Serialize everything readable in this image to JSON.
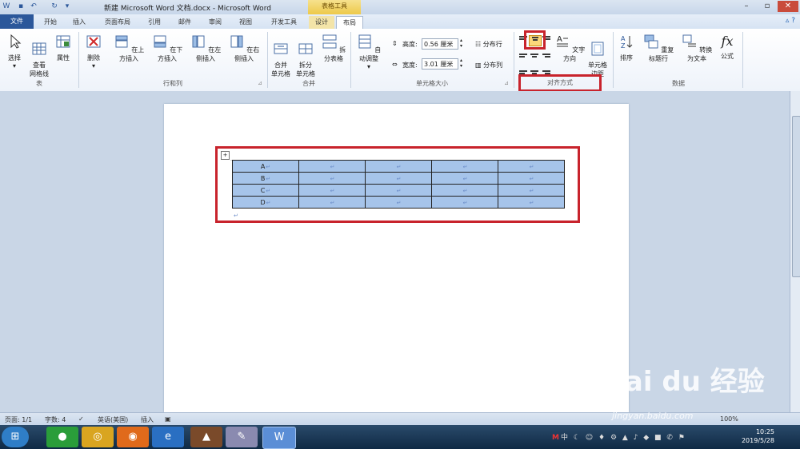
{
  "window": {
    "title": "新建 Microsoft Word 文档.docx - Microsoft Word",
    "context_tab_group": "表格工具",
    "app_icon": "W"
  },
  "tabs": [
    "开始",
    "插入",
    "页面布局",
    "引用",
    "邮件",
    "审阅",
    "视图",
    "开发工具"
  ],
  "file_tab": "文件",
  "context_tabs": [
    "设计",
    "布局"
  ],
  "ribbon": {
    "table": {
      "select": "选择",
      "gridlines": "查看\n网格线",
      "properties": "属性",
      "label": "表"
    },
    "rows_cols": {
      "delete": "删除",
      "insert_above": "在上方插入",
      "insert_below": "在下方插入",
      "insert_left": "在左侧插入",
      "insert_right": "在右侧插入",
      "label": "行和列"
    },
    "merge": {
      "merge_cells": "合并\n单元格",
      "split_cells": "拆分\n单元格",
      "split_table": "拆分表格",
      "label": "合并"
    },
    "cell_size": {
      "autofit": "自动调整",
      "height_label": "高度:",
      "height_value": "0.56 厘米",
      "width_label": "宽度:",
      "width_value": "3.01 厘米",
      "dist_rows": "分布行",
      "dist_cols": "分布列",
      "label": "单元格大小"
    },
    "alignment": {
      "text_direction": "文字方向",
      "cell_margins": "单元格\n边距",
      "label": "对齐方式"
    },
    "data": {
      "sort": "排序",
      "repeat_header": "重复标题行",
      "convert_text": "转换为文本",
      "formula": "公式",
      "label": "数据"
    }
  },
  "table_rows": [
    "A",
    "B",
    "C",
    "D"
  ],
  "paragraph_mark": "↵",
  "status": {
    "page": "页面: 1/1",
    "words": "字数: 4",
    "language": "英语(美国)",
    "insert": "插入",
    "zoom": "100%"
  },
  "taskbar": {
    "time": "10:25",
    "date": "2019/5/28",
    "ime": "中"
  },
  "watermark": {
    "main": "Bai du 经验",
    "sub": "jingyan.baidu.com"
  },
  "colors": {
    "accent": "#2b579a",
    "highlight": "#c8232c",
    "cell_fill": "#a6c4ea"
  }
}
